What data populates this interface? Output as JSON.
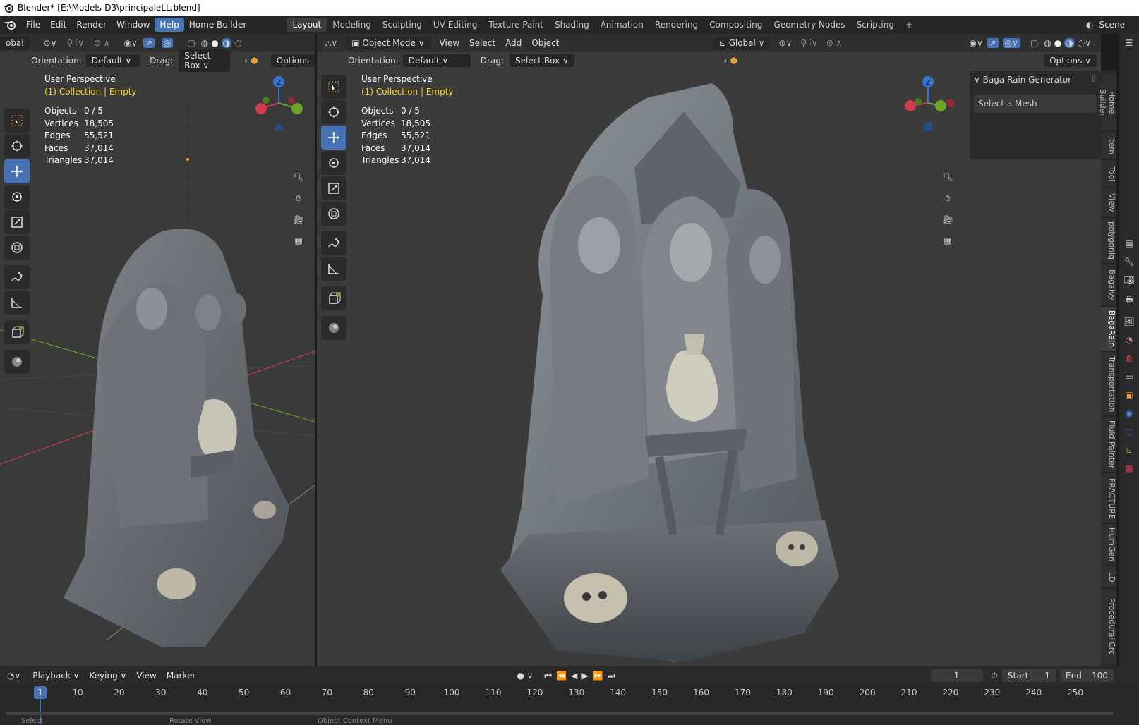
{
  "window_title": "Blender* [E:\\Models-D3\\principaleLL.blend]",
  "menu": [
    "File",
    "Edit",
    "Render",
    "Window",
    "Help",
    "Home Builder"
  ],
  "workspaces": [
    "Layout",
    "Modeling",
    "Sculpting",
    "UV Editing",
    "Texture Paint",
    "Shading",
    "Animation",
    "Rendering",
    "Compositing",
    "Geometry Nodes",
    "Scripting"
  ],
  "scene_label": "Scene",
  "left_viewport": {
    "transform_label": "obal",
    "orientation_label": "Orientation:",
    "orientation_value": "Default",
    "drag_label": "Drag:",
    "drag_value": "Select Box",
    "options": "Options",
    "view_name": "User Perspective",
    "collection": "(1) Collection | Empty"
  },
  "main_viewport": {
    "mode": "Object Mode",
    "menus": [
      "View",
      "Select",
      "Add",
      "Object"
    ],
    "transform": "Global",
    "orientation_label": "Orientation:",
    "orientation_value": "Default",
    "drag_label": "Drag:",
    "drag_value": "Select Box",
    "options": "Options",
    "view_name": "User Perspective",
    "collection": "(1) Collection | Empty"
  },
  "stats": {
    "objects_label": "Objects",
    "objects": "0 / 5",
    "vertices_label": "Vertices",
    "vertices": "18,505",
    "edges_label": "Edges",
    "edges": "55,521",
    "faces_label": "Faces",
    "faces": "37,014",
    "triangles_label": "Triangles",
    "triangles": "37,014"
  },
  "n_panel": {
    "title": "Baga Rain Generator",
    "button": "Select a Mesh"
  },
  "side_tabs": [
    "Home Builder",
    "Item",
    "Tool",
    "View",
    "polygoniq",
    "Bagalvy",
    "BagaRain",
    "Transportation",
    "Fluid Painter",
    "FRACTURE",
    "HumGen",
    "LD",
    "Procedural Cro"
  ],
  "active_side_tab": "BagaRain",
  "timeline": {
    "menus": [
      "Playback",
      "Keying",
      "View",
      "Marker"
    ],
    "current_frame": "1",
    "start_label": "Start",
    "start": "1",
    "end_label": "End",
    "end": "100",
    "ticks": [
      "10",
      "20",
      "30",
      "40",
      "50",
      "60",
      "70",
      "80",
      "90",
      "100",
      "110",
      "120",
      "130",
      "140",
      "150",
      "160",
      "170",
      "180",
      "190",
      "200",
      "210",
      "220",
      "230",
      "240",
      "250"
    ],
    "status_items": [
      "Select",
      "Rotate View",
      "Object Context Menu"
    ]
  },
  "colors": {
    "accent": "#4772b3",
    "viewport_bg": "#3b3b3b",
    "x_axis": "#d23c4f",
    "y_axis": "#6ea32a",
    "z_axis": "#2f73d3",
    "text_yellow": "#f2d321"
  }
}
